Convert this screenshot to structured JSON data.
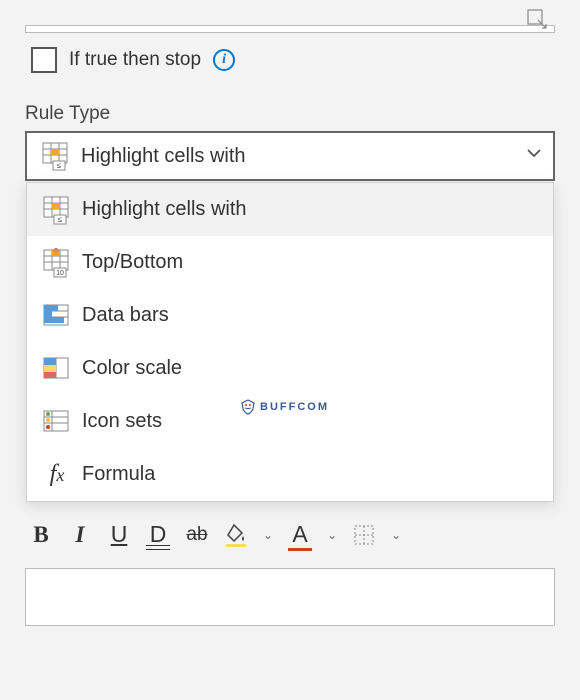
{
  "checkbox_label": "If true then stop",
  "section_label": "Rule Type",
  "selected": "Highlight cells with",
  "options": [
    "Highlight cells with",
    "Top/Bottom",
    "Data bars",
    "Color scale",
    "Icon sets",
    "Formula"
  ],
  "watermark": "BUFFCOM",
  "toolbar": {
    "bold": "B",
    "italic": "I",
    "underline": "U",
    "double_underline": "D",
    "strike": "ab",
    "font_color": "A"
  }
}
